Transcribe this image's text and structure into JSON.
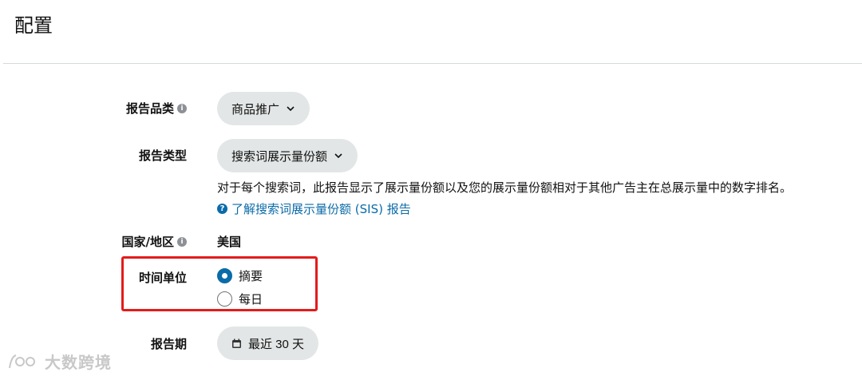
{
  "page": {
    "title": "配置"
  },
  "fields": {
    "category": {
      "label": "报告品类",
      "value": "商品推广"
    },
    "report_type": {
      "label": "报告类型",
      "value": "搜索词展示量份额",
      "description": "对于每个搜索词，此报告显示了展示量份额以及您的展示量份额相对于其他广告主在总展示量中的数字排名。",
      "help_link": "了解搜索词展示量份额 (SIS) 报告"
    },
    "country": {
      "label": "国家/地区",
      "value": "美国"
    },
    "time_unit": {
      "label": "时间单位",
      "options": [
        {
          "label": "摘要",
          "selected": true
        },
        {
          "label": "每日",
          "selected": false
        }
      ]
    },
    "report_period": {
      "label": "报告期",
      "value": "最近 30 天"
    }
  },
  "icons": {
    "info": "i",
    "help": "?",
    "chevron": "chevron-down-icon",
    "calendar": "calendar-icon"
  },
  "colors": {
    "accent": "#0b6ba8",
    "pill_bg": "#e3e6e6",
    "highlight": "#e31b1b"
  },
  "watermark": {
    "text": "大数跨境"
  }
}
